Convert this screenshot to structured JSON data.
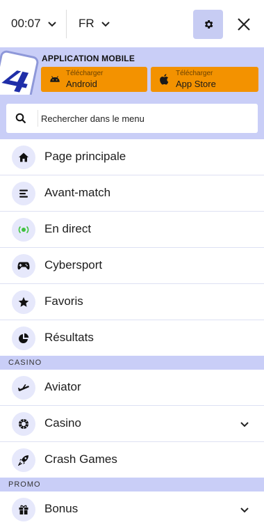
{
  "topbar": {
    "time": "00:07",
    "language": "FR"
  },
  "banner": {
    "title": "APPLICATION MOBILE",
    "android": {
      "small": "Télécharger",
      "label": "Android"
    },
    "apple": {
      "small": "Télécharger",
      "label": "App Store"
    },
    "colors": {
      "banner_bg": "#c9cef7",
      "download_button": "#f39200",
      "logo_blue": "#1f2ea8"
    }
  },
  "search": {
    "placeholder": "Rechercher dans le menu"
  },
  "menu": {
    "main": [
      {
        "label": "Page principale",
        "icon": "home-icon"
      },
      {
        "label": "Avant-match",
        "icon": "list-icon"
      },
      {
        "label": "En direct",
        "icon": "live-icon"
      },
      {
        "label": "Cybersport",
        "icon": "gamepad-icon"
      },
      {
        "label": "Favoris",
        "icon": "star-icon"
      },
      {
        "label": "Résultats",
        "icon": "pie-chart-icon"
      }
    ],
    "casino_section": "CASINO",
    "casino": [
      {
        "label": "Aviator",
        "icon": "airplane-icon"
      },
      {
        "label": "Casino",
        "icon": "poker-chip-icon"
      },
      {
        "label": "Crash Games",
        "icon": "rocket-icon"
      }
    ],
    "promo_section": "PROMO",
    "promo": [
      {
        "label": "Bonus",
        "icon": "gift-icon"
      }
    ]
  }
}
